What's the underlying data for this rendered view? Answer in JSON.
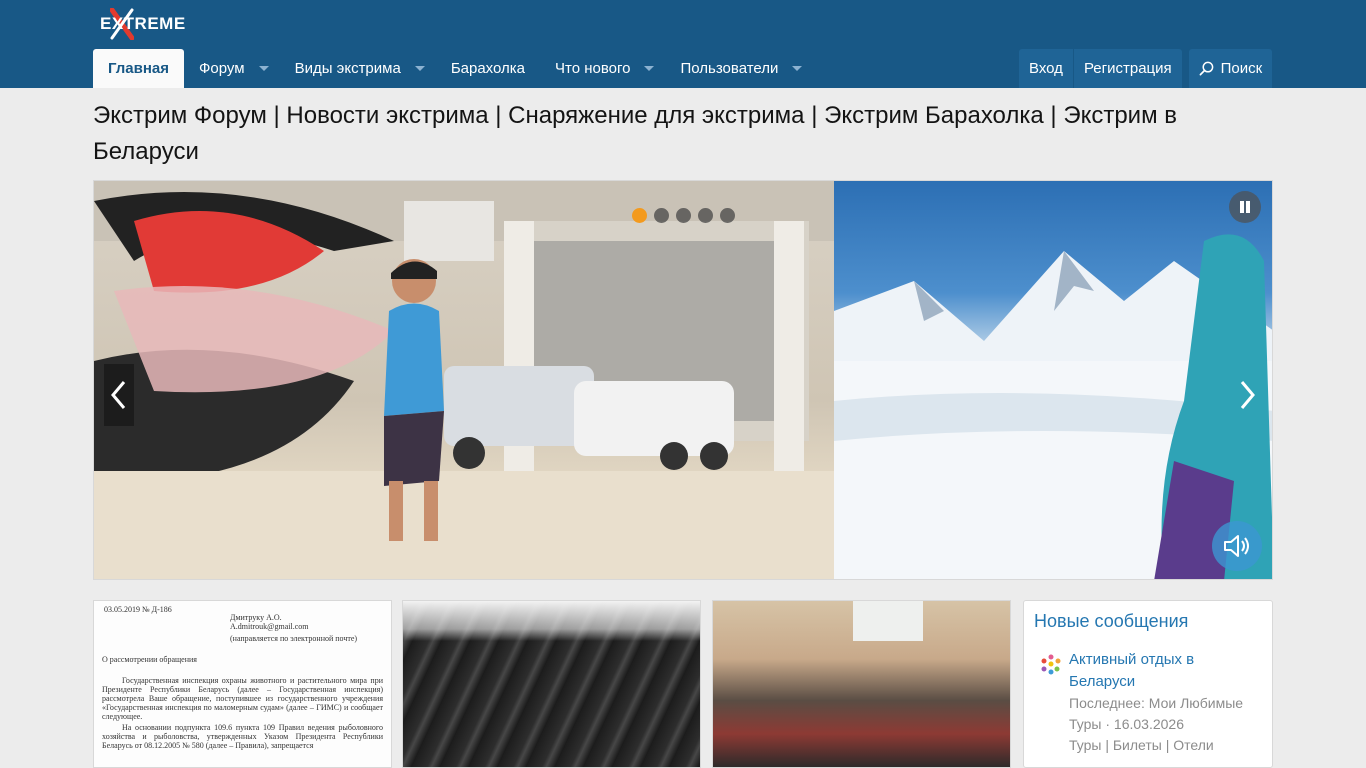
{
  "header": {
    "logo_text": "EXTREME"
  },
  "nav": {
    "items": [
      {
        "label": "Главная",
        "active": true,
        "has_dropdown": false
      },
      {
        "label": "Форум",
        "active": false,
        "has_dropdown": true
      },
      {
        "label": "Виды экстрима",
        "active": false,
        "has_dropdown": true
      },
      {
        "label": "Барахолка",
        "active": false,
        "has_dropdown": false
      },
      {
        "label": "Что нового",
        "active": false,
        "has_dropdown": true
      },
      {
        "label": "Пользователи",
        "active": false,
        "has_dropdown": true
      }
    ],
    "login_label": "Вход",
    "register_label": "Регистрация",
    "search_label": "Поиск"
  },
  "page": {
    "title": "Экстрим Форум | Новости экстрима | Снаряжение для экстрима | Экстрим Барахолка | Экстрим в Беларуси"
  },
  "slider": {
    "slide_count": 5,
    "active_slide": 1
  },
  "thumbs": {
    "doc": {
      "date_line": "03.05.2019 № Д-186",
      "addressee": "Дмитруку А.О.",
      "email": "A.dmitrouk@gmail.com",
      "note": "(направляется по электронной почте)",
      "subject": "О рассмотрении обращения",
      "para1": "Государственная инспекция охраны животного и растительного мира при Президенте Республики Беларусь (далее – Государственная инспекция) рассмотрела Ваше обращение, поступившее из государственного учреждения «Государственная инспекция по маломерным судам» (далее – ГИМС) и сообщает следующее.",
      "para2": "На основании подпункта 109.6 пункта 109 Правил ведения рыболовного хозяйства и рыболовства, утвержденных Указом Президента Республики Беларусь от 08.12.2005 № 580 (далее – Правила), запрещается"
    }
  },
  "new_posts": {
    "title": "Новые сообщения",
    "items": [
      {
        "title": "Активный отдых в Беларуси",
        "meta_prefix": "Последнее: Мои Любимые Туры",
        "date": "16.03.2026",
        "forum": "Туры | Билеты | Отели"
      }
    ]
  },
  "colors": {
    "header_bg": "#185886",
    "accent": "#2577b1",
    "active_dot": "#f39a1e"
  }
}
